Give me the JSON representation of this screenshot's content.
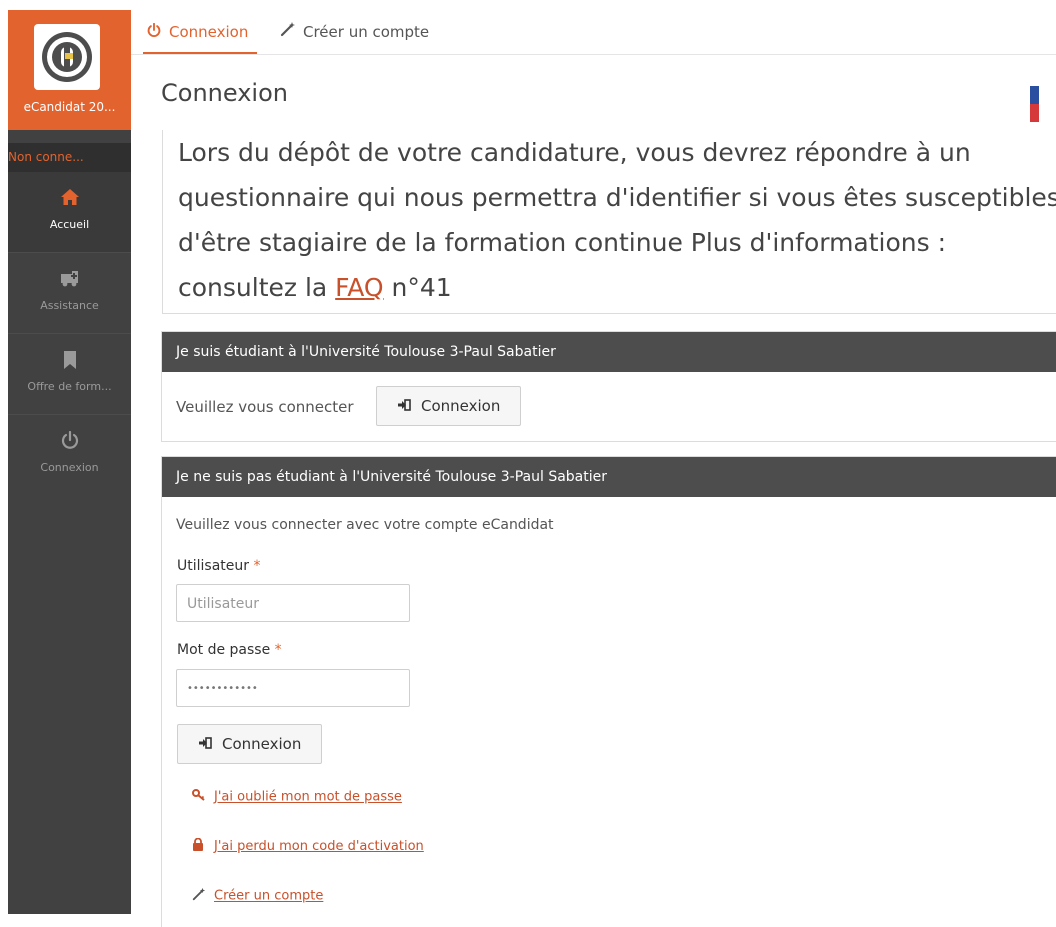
{
  "sidebar": {
    "brand_label": "eCandidat 20...",
    "user_status": "Non conne...",
    "items": [
      {
        "label": "Accueil",
        "icon": "home-icon"
      },
      {
        "label": "Assistance",
        "icon": "ambulance-icon"
      },
      {
        "label": "Offre de form...",
        "icon": "bookmark-icon"
      },
      {
        "label": "Connexion",
        "icon": "power-icon"
      }
    ]
  },
  "tabs": [
    {
      "label": "Connexion",
      "icon": "power-icon",
      "active": true
    },
    {
      "label": "Créer un compte",
      "icon": "magic-wand-icon",
      "active": false
    }
  ],
  "page_title": "Connexion",
  "info": {
    "text_line1": "Lors du dépôt de votre candidature, vous devrez répondre à un",
    "text_line2": "questionnaire qui nous permettra d'identifier si vous êtes susceptibles",
    "text_line3": "d'être stagiaire de la formation continue Plus d'informations :",
    "text_line4_prefix": "consultez la ",
    "faq_link": "FAQ",
    "text_line4_suffix": " n°41"
  },
  "ut3_panel": {
    "title": "Je suis étudiant à l'Université Toulouse 3-Paul Sabatier",
    "prompt": "Veuillez vous connecter",
    "button": "Connexion"
  },
  "other_panel": {
    "title": "Je ne suis pas étudiant à l'Université Toulouse 3-Paul Sabatier",
    "prompt": "Veuillez vous connecter avec votre compte eCandidat",
    "user_label": "Utilisateur",
    "user_placeholder": "Utilisateur",
    "password_label": "Mot de passe",
    "password_value": "••••••••••••",
    "required_mark": "*",
    "button": "Connexion",
    "forgot_password": "J'ai oublié mon mot de passe",
    "lost_code": "J'ai perdu mon code d'activation",
    "create_account": "Créer un compte"
  },
  "colors": {
    "accent": "#e2632e",
    "sidebar": "#414141",
    "panel_header": "#4d4d4d"
  }
}
